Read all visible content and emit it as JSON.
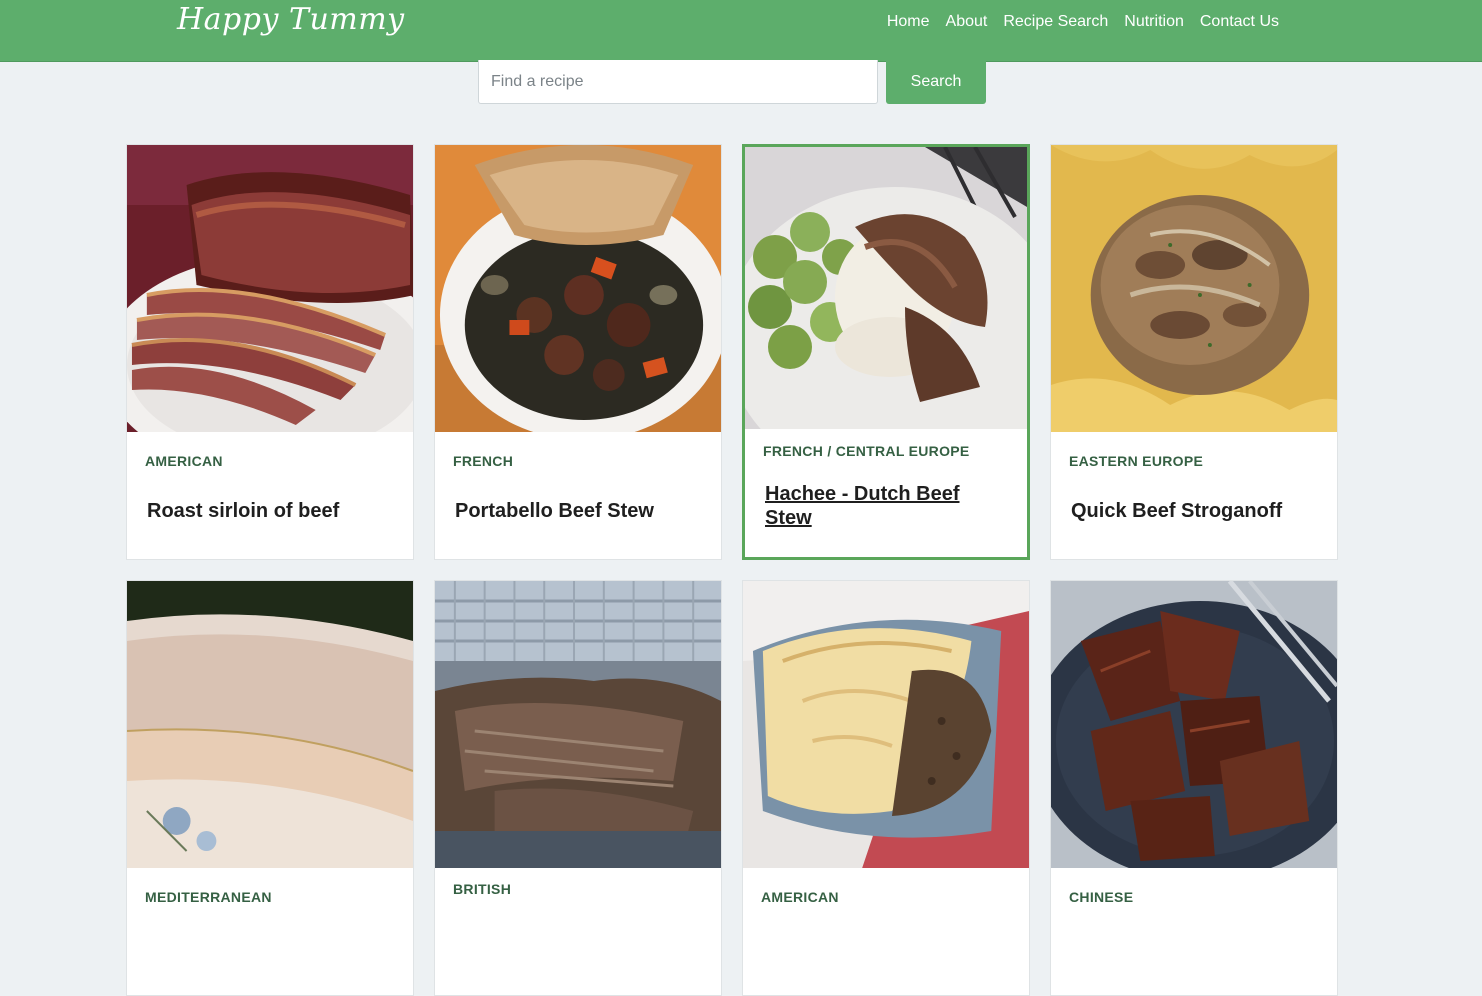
{
  "header": {
    "logo": "Happy Tummy",
    "nav": [
      "Home",
      "About",
      "Recipe Search",
      "Nutrition",
      "Contact Us"
    ]
  },
  "search": {
    "placeholder": "Find a recipe",
    "value": "",
    "button_label": "Search"
  },
  "recipes": [
    {
      "category": "AMERICAN",
      "title": "Roast sirloin of beef",
      "image": "roast-beef-image"
    },
    {
      "category": "FRENCH",
      "title": "Portabello Beef Stew",
      "image": "beef-stew-image"
    },
    {
      "category": "FRENCH / CENTRAL EUROPE",
      "title": "Hachee - Dutch Beef Stew",
      "image": "hachee-image"
    },
    {
      "category": "EASTERN EUROPE",
      "title": "Quick Beef Stroganoff",
      "image": "stroganoff-image"
    },
    {
      "category": "MEDITERRANEAN",
      "title": "",
      "image": "broth-cup-image"
    },
    {
      "category": "BRITISH",
      "title": "",
      "image": "pulled-beef-image"
    },
    {
      "category": "AMERICAN",
      "title": "",
      "image": "beef-pie-image"
    },
    {
      "category": "CHINESE",
      "title": "",
      "image": "braised-beef-image"
    }
  ],
  "colors": {
    "brand": "#5dae6c",
    "background": "#edf1f3",
    "category_text": "#356043",
    "active_border": "#5aa65a"
  }
}
